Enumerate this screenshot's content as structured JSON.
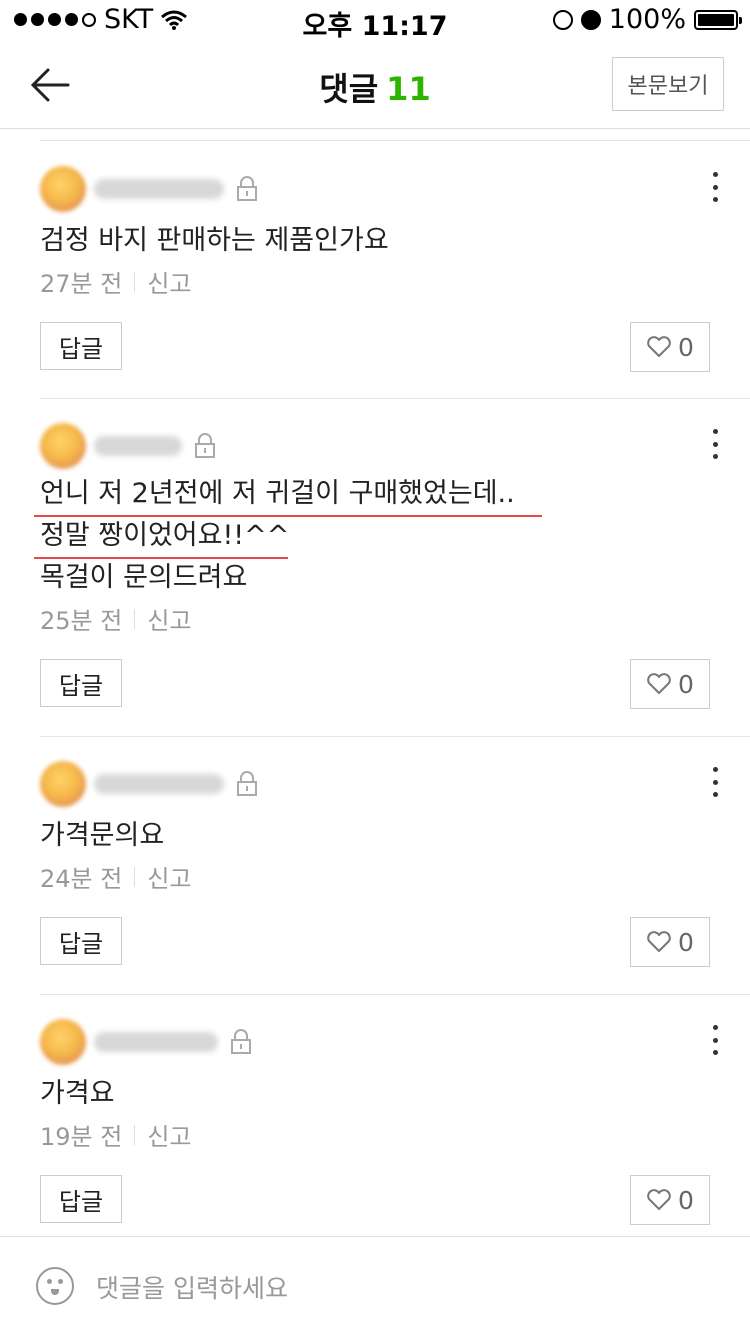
{
  "status_bar": {
    "carrier": "SKT",
    "time": "오후 11:17",
    "battery": "100%"
  },
  "header": {
    "title": "댓글",
    "count": "11",
    "view_post_label": "본문보기"
  },
  "comments": [
    {
      "text_lines": [
        "검정 바지 판매하는 제품인가요"
      ],
      "time": "27분 전",
      "report": "신고",
      "reply_label": "답글",
      "likes": "0"
    },
    {
      "text_lines": [
        "언니 저 2년전에 저 귀걸이 구매했었는데..",
        "정말 짱이었어요!!^^",
        "목걸이 문의드려요"
      ],
      "time": "25분 전",
      "report": "신고",
      "reply_label": "답글",
      "likes": "0"
    },
    {
      "text_lines": [
        "가격문의요"
      ],
      "time": "24분 전",
      "report": "신고",
      "reply_label": "답글",
      "likes": "0"
    },
    {
      "text_lines": [
        "가격요"
      ],
      "time": "19분 전",
      "report": "신고",
      "reply_label": "답글",
      "likes": "0"
    }
  ],
  "input": {
    "placeholder": "댓글을 입력하세요"
  },
  "colors": {
    "accent": "#2db400",
    "underline": "#e24b4b"
  }
}
